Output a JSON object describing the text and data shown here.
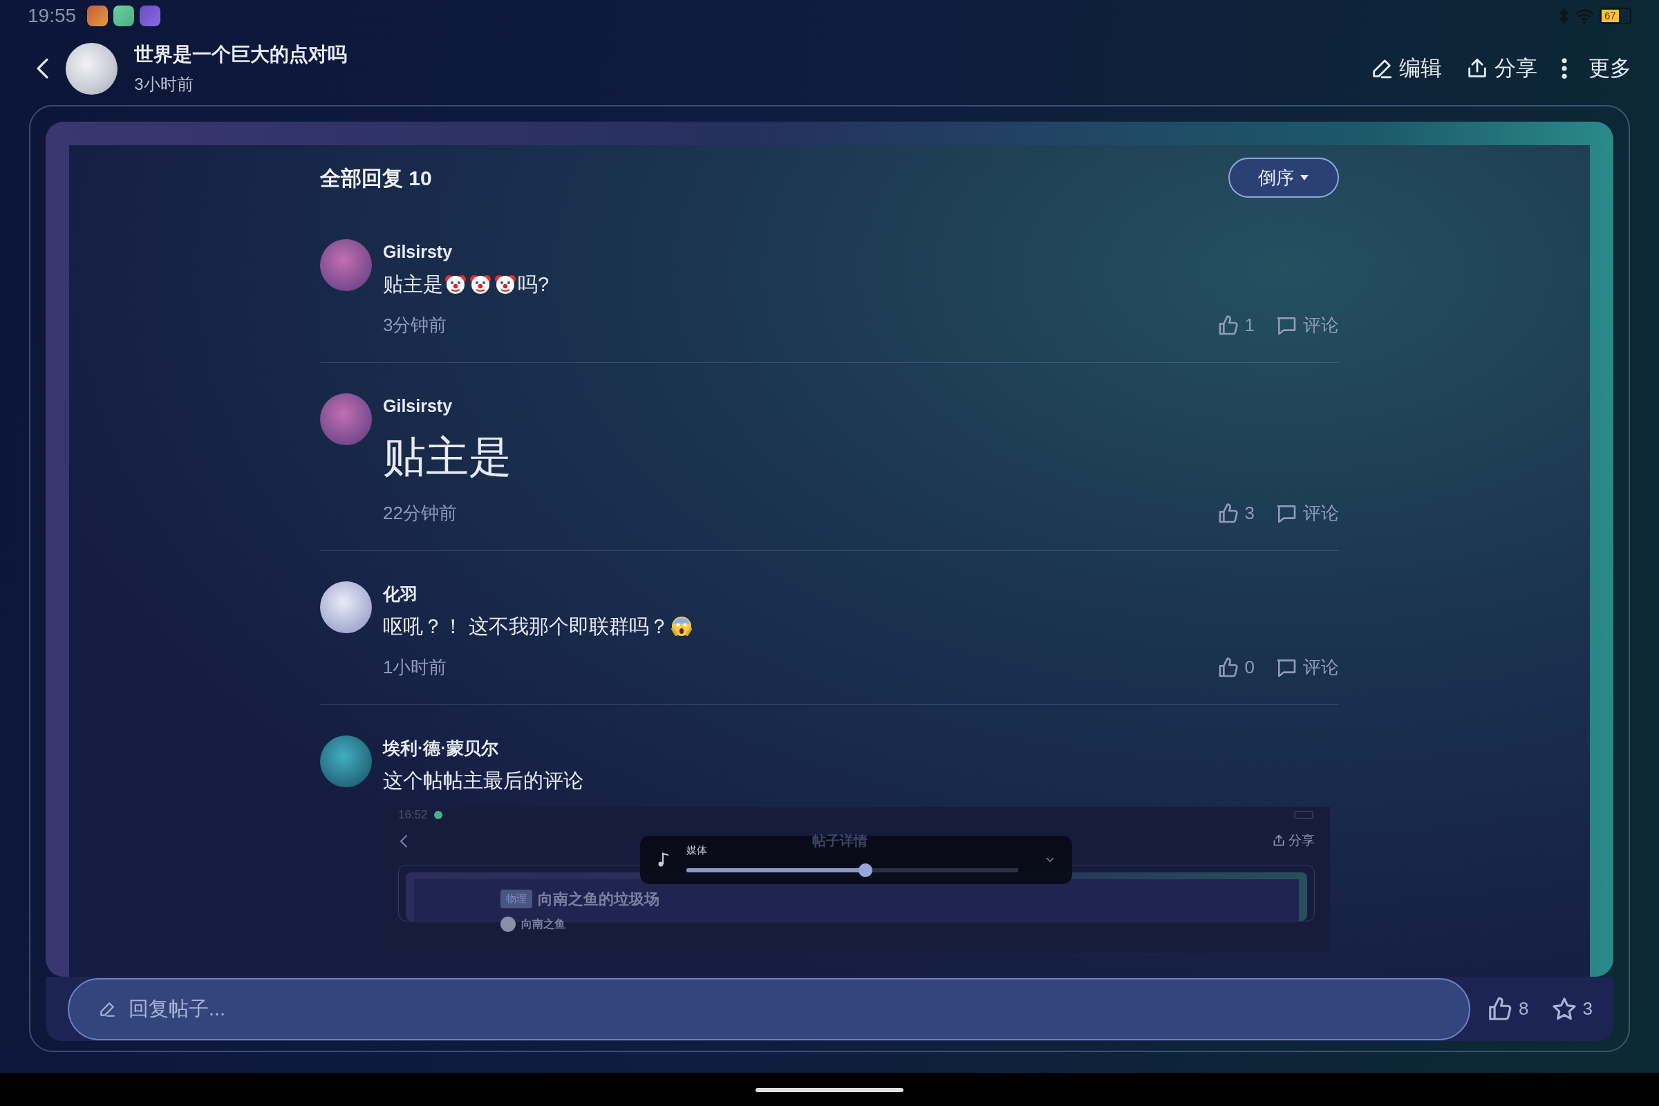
{
  "status_bar": {
    "time": "19:55",
    "battery": "67"
  },
  "header": {
    "title": "世界是一个巨大的点对吗",
    "subtitle": "3小时前",
    "actions": [
      {
        "kind": "edit",
        "label": "编辑"
      },
      {
        "kind": "share",
        "label": "分享"
      },
      {
        "kind": "more",
        "label": "更多"
      }
    ]
  },
  "replies": {
    "heading": "全部回复 10",
    "sort_button": "倒序"
  },
  "comments": [
    {
      "kind": "normal",
      "author": "Gilsirsty",
      "content": [
        {
          "kind": "text",
          "text": "贴主是"
        },
        {
          "kind": "clown-emoji"
        },
        {
          "kind": "clown-emoji"
        },
        {
          "kind": "clown-emoji"
        },
        {
          "kind": "text",
          "text": "吗?"
        }
      ],
      "time": "3分钟前",
      "likes": "1",
      "comment_label": "评论"
    },
    {
      "kind": "large",
      "author": "Gilsirsty",
      "content": [
        {
          "kind": "text",
          "text": "贴主是"
        }
      ],
      "time": "22分钟前",
      "likes": "3",
      "comment_label": "评论"
    },
    {
      "kind": "normal",
      "author": "化羽",
      "content": [
        {
          "kind": "text",
          "text": "呕吼？！ 这不我那个即联群吗？"
        },
        {
          "kind": "scream-emoji"
        }
      ],
      "time": "1小时前",
      "likes": "0",
      "comment_label": "评论"
    },
    {
      "kind": "normal",
      "author": "埃利·德·蒙贝尔",
      "content": [
        {
          "kind": "text",
          "text": "这个帖帖主最后的评论"
        }
      ],
      "attachment": {
        "time": "16:52",
        "title": "帖子详情",
        "share": "分享",
        "volume": {
          "label": "媒体",
          "level": 0.54
        },
        "tag": "物理",
        "post_title": "向南之鱼的垃圾场",
        "author": "向南之鱼"
      }
    }
  ],
  "reply_bar": {
    "placeholder": "回复帖子...",
    "likes": "8",
    "favorites": "3"
  }
}
